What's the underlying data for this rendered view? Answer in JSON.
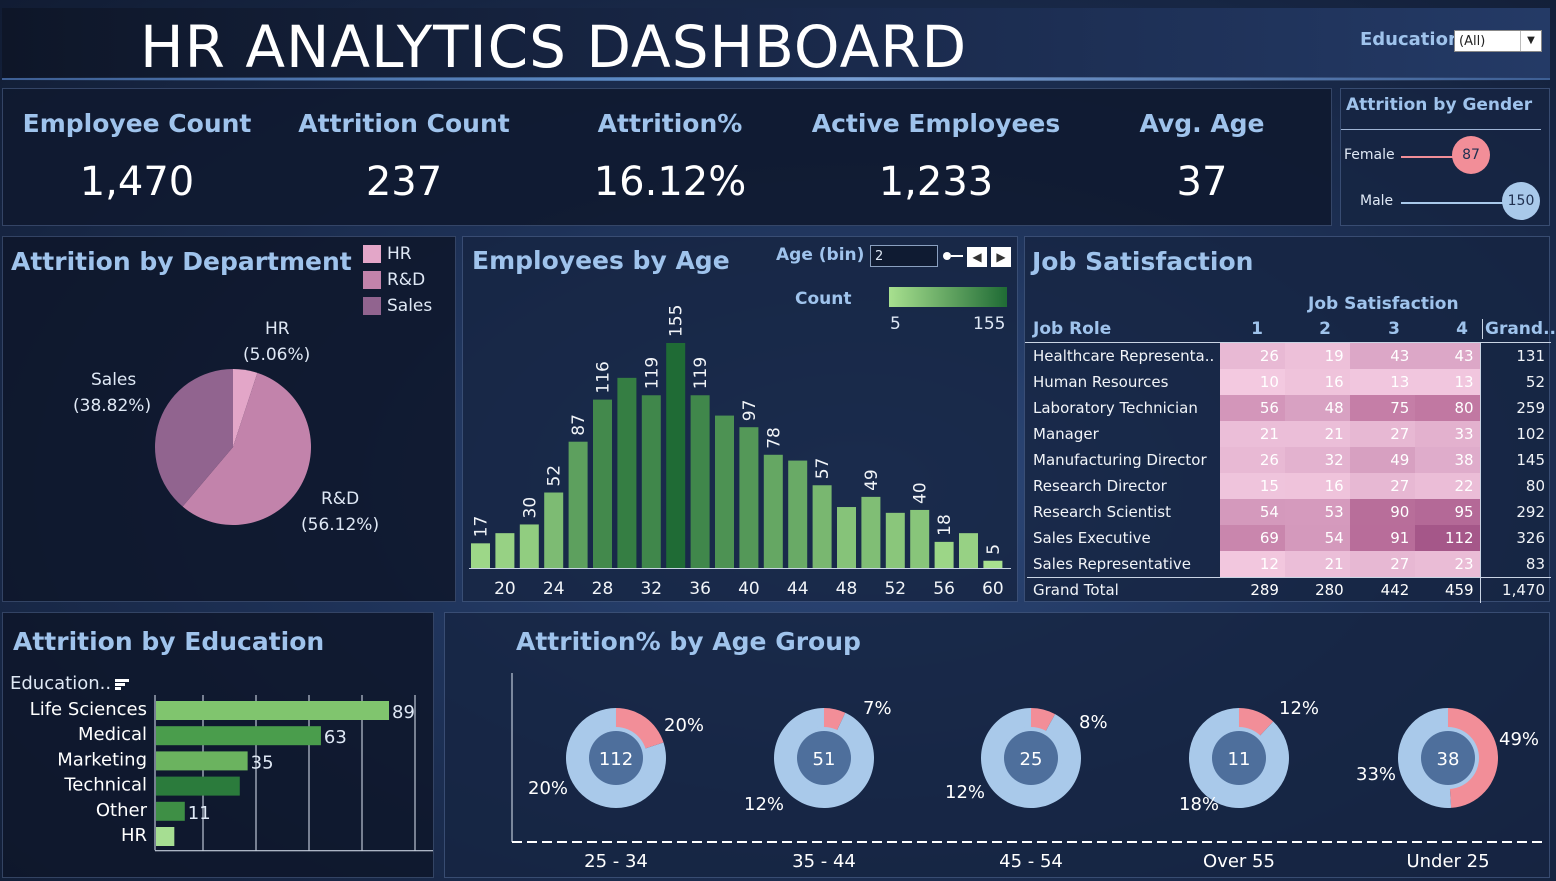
{
  "title": "HR ANALYTICS DASHBOARD",
  "filter": {
    "label": "Education",
    "value": "(All)"
  },
  "kpis": [
    {
      "label": "Employee Count",
      "value": "1,470"
    },
    {
      "label": "Attrition Count",
      "value": "237"
    },
    {
      "label": "Attrition%",
      "value": "16.12%"
    },
    {
      "label": "Active Employees",
      "value": "1,233"
    },
    {
      "label": "Avg. Age",
      "value": "37"
    }
  ],
  "gender": {
    "title": "Attrition by Gender",
    "rows": [
      {
        "label": "Female",
        "value": "87",
        "color": "#f28e98"
      },
      {
        "label": "Male",
        "value": "150",
        "color": "#a9c9ea"
      }
    ]
  },
  "department": {
    "title": "Attrition by Department",
    "legend": [
      "HR",
      "R&D",
      "Sales"
    ],
    "labels": [
      {
        "name": "HR",
        "pct": "(5.06%)"
      },
      {
        "name": "R&D",
        "pct": "(56.12%)"
      },
      {
        "name": "Sales",
        "pct": "(38.82%)"
      }
    ]
  },
  "age": {
    "title": "Employees by Age",
    "bin_label": "Age (bin)",
    "bin_value": "2",
    "count_label": "Count",
    "count_min": "5",
    "count_max": "155"
  },
  "job": {
    "title": "Job Satisfaction",
    "col_group": "Job Satisfaction",
    "row_header": "Job Role",
    "cols": [
      "1",
      "2",
      "3",
      "4"
    ],
    "grand_header": "Grand..",
    "rows": [
      {
        "role": "Healthcare Representa..",
        "v": [
          "26",
          "19",
          "43",
          "43"
        ],
        "total": "131"
      },
      {
        "role": "Human Resources",
        "v": [
          "10",
          "16",
          "13",
          "13"
        ],
        "total": "52"
      },
      {
        "role": "Laboratory Technician",
        "v": [
          "56",
          "48",
          "75",
          "80"
        ],
        "total": "259"
      },
      {
        "role": "Manager",
        "v": [
          "21",
          "21",
          "27",
          "33"
        ],
        "total": "102"
      },
      {
        "role": "Manufacturing Director",
        "v": [
          "26",
          "32",
          "49",
          "38"
        ],
        "total": "145"
      },
      {
        "role": "Research Director",
        "v": [
          "15",
          "16",
          "27",
          "22"
        ],
        "total": "80"
      },
      {
        "role": "Research Scientist",
        "v": [
          "54",
          "53",
          "90",
          "95"
        ],
        "total": "292"
      },
      {
        "role": "Sales Executive",
        "v": [
          "69",
          "54",
          "91",
          "112"
        ],
        "total": "326"
      },
      {
        "role": "Sales Representative",
        "v": [
          "12",
          "21",
          "27",
          "23"
        ],
        "total": "83"
      }
    ],
    "grand_total": {
      "role": "Grand Total",
      "v": [
        "289",
        "280",
        "442",
        "459"
      ],
      "total": "1,470"
    }
  },
  "education": {
    "title": "Attrition by Education",
    "axis_label": "Education.."
  },
  "agegroup": {
    "title": "Attrition%  by Age Group"
  },
  "chart_data": [
    {
      "type": "pie",
      "title": "Attrition by Department",
      "categories": [
        "HR",
        "R&D",
        "Sales"
      ],
      "values": [
        5.06,
        56.12,
        38.82
      ],
      "colors": [
        "#e3a6c8",
        "#c283ab",
        "#91648f"
      ]
    },
    {
      "type": "bar",
      "title": "Employees by Age",
      "x": [
        18,
        20,
        22,
        24,
        26,
        28,
        30,
        32,
        34,
        36,
        38,
        40,
        42,
        44,
        46,
        48,
        50,
        52,
        54,
        56,
        58,
        60
      ],
      "values": [
        17,
        24,
        30,
        52,
        87,
        116,
        131,
        119,
        155,
        119,
        105,
        97,
        78,
        74,
        57,
        42,
        49,
        38,
        40,
        18,
        24,
        5
      ],
      "value_labels": [
        "17",
        "",
        "30",
        "52",
        "87",
        "116",
        "",
        "119",
        "155",
        "119",
        "",
        "97",
        "78",
        "",
        "57",
        "",
        "49",
        "",
        "40",
        "18",
        "",
        "5"
      ],
      "tick_labels": [
        "20",
        "24",
        "28",
        "32",
        "36",
        "40",
        "44",
        "48",
        "52",
        "56",
        "60"
      ],
      "tick_values": [
        20,
        24,
        28,
        32,
        36,
        40,
        44,
        48,
        52,
        56,
        60
      ],
      "color_scale": [
        "#a8e08f",
        "#1f6b35"
      ]
    },
    {
      "type": "bar",
      "title": "Attrition by Education",
      "orientation": "horizontal",
      "categories": [
        "Life Sciences",
        "Medical",
        "Marketing",
        "Technical",
        "Other",
        "HR"
      ],
      "values": [
        89,
        63,
        35,
        32,
        11,
        7
      ],
      "value_labels": [
        "89",
        "63",
        "35",
        "",
        "11",
        ""
      ],
      "colors": [
        "#80c56e",
        "#4a9d4c",
        "#6bb35f",
        "#2b7b3c",
        "#3e8f45",
        "#a6de92"
      ],
      "xlim": [
        0,
        93
      ]
    },
    {
      "type": "pie",
      "title": "Attrition%  by Age Group",
      "groups": [
        {
          "label": "25 - 34",
          "count": "112",
          "attrition_pct": 20,
          "pct_labels": [
            "20%",
            "20%"
          ]
        },
        {
          "label": "35 - 44",
          "count": "51",
          "attrition_pct": 7,
          "pct_labels": [
            "7%",
            "12%"
          ]
        },
        {
          "label": "45 - 54",
          "count": "25",
          "attrition_pct": 8,
          "pct_labels": [
            "8%",
            "12%"
          ]
        },
        {
          "label": "Over 55",
          "count": "11",
          "attrition_pct": 12,
          "pct_labels": [
            "12%",
            "18%"
          ]
        },
        {
          "label": "Under 25",
          "count": "38",
          "attrition_pct": 49,
          "pct_labels": [
            "49%",
            "33%"
          ]
        }
      ],
      "colors": [
        "#f28e98",
        "#a9c9ea"
      ]
    }
  ]
}
